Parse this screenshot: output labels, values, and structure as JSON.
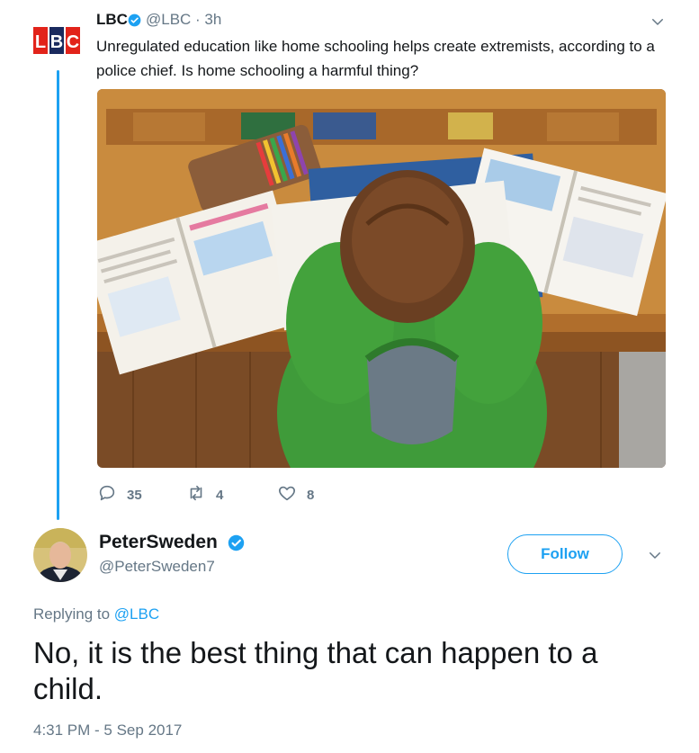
{
  "quoted_tweet": {
    "avatar_text": "LBC",
    "name": "LBC",
    "handle": "@LBC · 3h",
    "text": "Unregulated education like home schooling helps create extremists, according to a police chief. Is home schooling a harmful thing?",
    "actions": {
      "replies": "35",
      "retweets": "4",
      "likes": "8"
    }
  },
  "tweet": {
    "name": "PeterSweden",
    "handle": "@PeterSweden7",
    "follow_label": "Follow",
    "replying_prefix": "Replying to",
    "replying_mention": "@LBC",
    "text": "No, it is the best thing that can happen to a child.",
    "timestamp": "4:31 PM - 5 Sep 2017"
  },
  "colors": {
    "accent": "#1da1f2",
    "secondary_text": "#657786",
    "lbc_red": "#e2231a",
    "lbc_navy": "#1a2a5e"
  }
}
